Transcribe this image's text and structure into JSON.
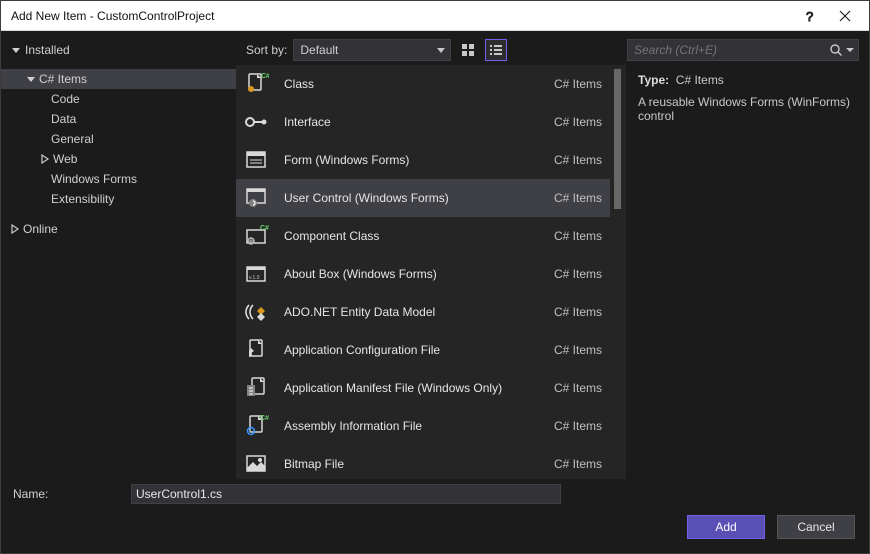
{
  "title": "Add New Item - CustomControlProject",
  "treeTop": "Installed",
  "treeCs": "C# Items",
  "treeItems": {
    "code": "Code",
    "data": "Data",
    "general": "General",
    "web": "Web",
    "wf": "Windows Forms",
    "ext": "Extensibility"
  },
  "treeOnline": "Online",
  "sort": {
    "label": "Sort by:",
    "value": "Default"
  },
  "search": {
    "placeholder": "Search (Ctrl+E)"
  },
  "templates": [
    {
      "name": "Class",
      "cat": "C# Items",
      "icon": "class"
    },
    {
      "name": "Interface",
      "cat": "C# Items",
      "icon": "interface"
    },
    {
      "name": "Form (Windows Forms)",
      "cat": "C# Items",
      "icon": "form"
    },
    {
      "name": "User Control (Windows Forms)",
      "cat": "C# Items",
      "icon": "usercontrol"
    },
    {
      "name": "Component Class",
      "cat": "C# Items",
      "icon": "component"
    },
    {
      "name": "About Box (Windows Forms)",
      "cat": "C# Items",
      "icon": "aboutbox"
    },
    {
      "name": "ADO.NET Entity Data Model",
      "cat": "C# Items",
      "icon": "adonet"
    },
    {
      "name": "Application Configuration File",
      "cat": "C# Items",
      "icon": "config"
    },
    {
      "name": "Application Manifest File (Windows Only)",
      "cat": "C# Items",
      "icon": "manifest"
    },
    {
      "name": "Assembly Information File",
      "cat": "C# Items",
      "icon": "asm"
    },
    {
      "name": "Bitmap File",
      "cat": "C# Items",
      "icon": "bitmap"
    }
  ],
  "selectedIndex": 3,
  "info": {
    "typeLabel": "Type:",
    "typeValue": "C# Items",
    "desc": "A reusable Windows Forms (WinForms) control"
  },
  "nameRow": {
    "label": "Name:",
    "value": "UserControl1.cs"
  },
  "buttons": {
    "add": "Add",
    "cancel": "Cancel"
  }
}
